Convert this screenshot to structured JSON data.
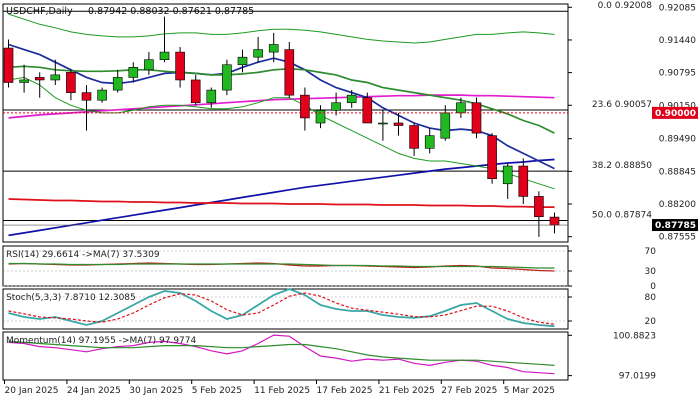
{
  "chart_data": {
    "type": "candlestick",
    "title": "USDCHF,Daily",
    "ohlc_header": "0.87942 0.88032 0.87621 0.87785",
    "price_scale": {
      "ylim": [
        0.8745,
        0.9215
      ],
      "ticks": [
        "0.92085",
        "0.91440",
        "0.90795",
        "0.90150",
        "0.89490",
        "0.88845",
        "0.88200",
        "0.87555"
      ],
      "last_price": "0.87785",
      "highlight_level": "0.90000",
      "colors": {
        "last_price": "#000000",
        "highlight_level": "#e0001b"
      }
    },
    "x_tick_labels": [
      "20 Jan 2025",
      "24 Jan 2025",
      "30 Jan 2025",
      "5 Feb 2025",
      "11 Feb 2025",
      "17 Feb 2025",
      "21 Feb 2025",
      "27 Feb 2025",
      "5 Mar 2025"
    ],
    "fib_levels": [
      {
        "label": "0.0 0.92008",
        "value": 0.92008
      },
      {
        "label": "23.6 0.90057",
        "value": 0.90057
      },
      {
        "label": "38.2 0.88850",
        "value": 0.8885
      },
      {
        "label": "50.0 0.87874",
        "value": 0.87874
      }
    ],
    "candles": [
      {
        "o": 0.9128,
        "h": 0.9145,
        "l": 0.905,
        "c": 0.906
      },
      {
        "o": 0.906,
        "h": 0.9095,
        "l": 0.904,
        "c": 0.9065
      },
      {
        "o": 0.907,
        "h": 0.908,
        "l": 0.903,
        "c": 0.9065
      },
      {
        "o": 0.9065,
        "h": 0.9105,
        "l": 0.9055,
        "c": 0.9075
      },
      {
        "o": 0.908,
        "h": 0.9085,
        "l": 0.9025,
        "c": 0.904
      },
      {
        "o": 0.904,
        "h": 0.9055,
        "l": 0.8965,
        "c": 0.9025
      },
      {
        "o": 0.9025,
        "h": 0.905,
        "l": 0.902,
        "c": 0.9045
      },
      {
        "o": 0.9045,
        "h": 0.9085,
        "l": 0.904,
        "c": 0.907
      },
      {
        "o": 0.907,
        "h": 0.91,
        "l": 0.906,
        "c": 0.909
      },
      {
        "o": 0.9085,
        "h": 0.912,
        "l": 0.9075,
        "c": 0.9105
      },
      {
        "o": 0.9105,
        "h": 0.919,
        "l": 0.91,
        "c": 0.912
      },
      {
        "o": 0.912,
        "h": 0.913,
        "l": 0.905,
        "c": 0.9065
      },
      {
        "o": 0.9065,
        "h": 0.9075,
        "l": 0.9015,
        "c": 0.902
      },
      {
        "o": 0.902,
        "h": 0.905,
        "l": 0.901,
        "c": 0.9045
      },
      {
        "o": 0.9045,
        "h": 0.9105,
        "l": 0.9035,
        "c": 0.9095
      },
      {
        "o": 0.9095,
        "h": 0.9125,
        "l": 0.908,
        "c": 0.911
      },
      {
        "o": 0.911,
        "h": 0.915,
        "l": 0.91,
        "c": 0.9125
      },
      {
        "o": 0.912,
        "h": 0.9158,
        "l": 0.91,
        "c": 0.9135
      },
      {
        "o": 0.9125,
        "h": 0.914,
        "l": 0.903,
        "c": 0.9035
      },
      {
        "o": 0.9035,
        "h": 0.905,
        "l": 0.8965,
        "c": 0.899
      },
      {
        "o": 0.898,
        "h": 0.9015,
        "l": 0.897,
        "c": 0.9005
      },
      {
        "o": 0.9005,
        "h": 0.904,
        "l": 0.8995,
        "c": 0.902
      },
      {
        "o": 0.902,
        "h": 0.9045,
        "l": 0.901,
        "c": 0.9035
      },
      {
        "o": 0.903,
        "h": 0.904,
        "l": 0.898,
        "c": 0.898
      },
      {
        "o": 0.898,
        "h": 0.9005,
        "l": 0.8945,
        "c": 0.898
      },
      {
        "o": 0.898,
        "h": 0.9,
        "l": 0.8955,
        "c": 0.8975
      },
      {
        "o": 0.8975,
        "h": 0.898,
        "l": 0.8915,
        "c": 0.893
      },
      {
        "o": 0.893,
        "h": 0.897,
        "l": 0.892,
        "c": 0.8955
      },
      {
        "o": 0.895,
        "h": 0.9015,
        "l": 0.8945,
        "c": 0.9
      },
      {
        "o": 0.9,
        "h": 0.903,
        "l": 0.899,
        "c": 0.902
      },
      {
        "o": 0.902,
        "h": 0.903,
        "l": 0.895,
        "c": 0.896
      },
      {
        "o": 0.8955,
        "h": 0.896,
        "l": 0.886,
        "c": 0.887
      },
      {
        "o": 0.886,
        "h": 0.89,
        "l": 0.883,
        "c": 0.8895
      },
      {
        "o": 0.8895,
        "h": 0.891,
        "l": 0.882,
        "c": 0.8835
      },
      {
        "o": 0.8835,
        "h": 0.8845,
        "l": 0.8755,
        "c": 0.8795
      },
      {
        "o": 0.87942,
        "h": 0.88032,
        "l": 0.87621,
        "c": 0.87785
      }
    ],
    "overlays": [
      {
        "color": "#1111aa",
        "values": [
          0.8758,
          0.8763,
          0.8768,
          0.8773,
          0.8778,
          0.8783,
          0.8788,
          0.8793,
          0.8798,
          0.8803,
          0.8808,
          0.8813,
          0.8818,
          0.8823,
          0.8828,
          0.8833,
          0.8838,
          0.8843,
          0.8848,
          0.8853,
          0.8857,
          0.8861,
          0.8865,
          0.8869,
          0.8873,
          0.8877,
          0.8881,
          0.8885,
          0.8889,
          0.8892,
          0.8895,
          0.8898,
          0.8901,
          0.8903,
          0.8906,
          0.8908
        ]
      },
      {
        "color": "#e0101b",
        "values": [
          0.883,
          0.8829,
          0.8828,
          0.8827,
          0.8827,
          0.8826,
          0.8825,
          0.8825,
          0.8824,
          0.8824,
          0.8823,
          0.8823,
          0.8822,
          0.8822,
          0.8822,
          0.8821,
          0.8821,
          0.8821,
          0.882,
          0.882,
          0.882,
          0.8819,
          0.8819,
          0.8819,
          0.8818,
          0.8818,
          0.8818,
          0.8817,
          0.8817,
          0.8817,
          0.8816,
          0.8816,
          0.8815,
          0.8815,
          0.8814,
          0.8814
        ]
      },
      {
        "color": "#e21ccf",
        "values": [
          0.899,
          0.8993,
          0.8996,
          0.8998,
          0.9,
          0.9002,
          0.9004,
          0.9006,
          0.9008,
          0.901,
          0.9012,
          0.9014,
          0.9016,
          0.9018,
          0.902,
          0.9022,
          0.9024,
          0.9026,
          0.9027,
          0.9028,
          0.9029,
          0.903,
          0.9031,
          0.9032,
          0.9033,
          0.9034,
          0.9034,
          0.9035,
          0.9035,
          0.9035,
          0.9034,
          0.9034,
          0.9033,
          0.9032,
          0.9031,
          0.903
        ]
      },
      {
        "color": "#1c2c9c",
        "values": [
          0.9135,
          0.9125,
          0.9115,
          0.91,
          0.9085,
          0.907,
          0.906,
          0.9058,
          0.9062,
          0.907,
          0.9078,
          0.908,
          0.9078,
          0.9075,
          0.9078,
          0.909,
          0.91,
          0.9108,
          0.91,
          0.9085,
          0.9065,
          0.905,
          0.904,
          0.903,
          0.901,
          0.8995,
          0.898,
          0.897,
          0.8965,
          0.8968,
          0.8965,
          0.8955,
          0.8935,
          0.892,
          0.8905,
          0.889
        ]
      },
      {
        "color": "#2e8b2e",
        "values": [
          0.909,
          0.9092,
          0.909,
          0.9085,
          0.9083,
          0.9082,
          0.9082,
          0.9083,
          0.9085,
          0.9085,
          0.9082,
          0.908,
          0.9078,
          0.9075,
          0.9075,
          0.9077,
          0.908,
          0.9085,
          0.9087,
          0.9085,
          0.908,
          0.9075,
          0.9065,
          0.906,
          0.905,
          0.9045,
          0.904,
          0.9035,
          0.903,
          0.9025,
          0.9018,
          0.9008,
          0.8998,
          0.8985,
          0.8975,
          0.896
        ]
      },
      {
        "color": "#1e9a1e",
        "values": [
          0.9195,
          0.9185,
          0.9175,
          0.9168,
          0.916,
          0.9155,
          0.9152,
          0.915,
          0.915,
          0.9152,
          0.9156,
          0.9158,
          0.9158,
          0.9155,
          0.9155,
          0.9158,
          0.9162,
          0.9165,
          0.9165,
          0.9163,
          0.916,
          0.9155,
          0.915,
          0.9145,
          0.9142,
          0.914,
          0.9138,
          0.914,
          0.9145,
          0.915,
          0.9155,
          0.9155,
          0.9158,
          0.916,
          0.9158,
          0.9155
        ]
      },
      {
        "color": "#1e9a1e",
        "values": [
          0.9065,
          0.907,
          0.9055,
          0.903,
          0.9015,
          0.9005,
          0.9,
          0.9,
          0.9005,
          0.9012,
          0.9015,
          0.9015,
          0.9012,
          0.9008,
          0.9008,
          0.9012,
          0.902,
          0.903,
          0.903,
          0.9015,
          0.8995,
          0.898,
          0.8965,
          0.895,
          0.8935,
          0.892,
          0.891,
          0.8905,
          0.8905,
          0.89,
          0.8895,
          0.889,
          0.888,
          0.887,
          0.886,
          0.885
        ]
      }
    ],
    "indicators": [
      {
        "label": "RSI(14) 29.6614 ->MA(7) 37.5309",
        "ylim": [
          0,
          80
        ],
        "ticks": [
          {
            "label": "70",
            "value": 70
          },
          {
            "label": "30",
            "value": 30
          },
          {
            "label": "0",
            "value": 0
          }
        ],
        "series": [
          {
            "color": "#c0201b",
            "values": [
              44,
              45,
              44,
              43,
              42,
              42,
              43,
              44,
              45,
              46,
              45,
              44,
              43,
              43,
              44,
              45,
              46,
              45,
              42,
              40,
              40,
              41,
              41,
              40,
              39,
              38,
              37,
              38,
              40,
              41,
              40,
              36,
              35,
              33,
              31,
              30
            ]
          },
          {
            "color": "#2e8b2e",
            "values": [
              45,
              45,
              44,
              44,
              43,
              43,
              43,
              43,
              44,
              44,
              44,
              44,
              44,
              44,
              44,
              44,
              44,
              44,
              44,
              43,
              42,
              41,
              41,
              41,
              40,
              40,
              39,
              39,
              39,
              39,
              39,
              39,
              38,
              37,
              36,
              36
            ]
          }
        ]
      },
      {
        "label": "Stoch(5,3,3) 7.8710 12.3085",
        "ylim": [
          0,
          100
        ],
        "ticks": [
          {
            "label": "80",
            "value": 80
          },
          {
            "label": "20",
            "value": 20
          }
        ],
        "series": [
          {
            "color": "#3aa6a6",
            "values": [
              40,
              30,
              25,
              30,
              20,
              10,
              20,
              40,
              60,
              80,
              95,
              90,
              70,
              45,
              25,
              35,
              60,
              85,
              100,
              85,
              60,
              50,
              45,
              45,
              35,
              30,
              28,
              32,
              45,
              60,
              65,
              45,
              25,
              15,
              10,
              7
            ]
          },
          {
            "color": "#e0101b",
            "values": [
              45,
              38,
              30,
              28,
              25,
              20,
              17,
              25,
              40,
              60,
              78,
              88,
              85,
              70,
              48,
              35,
              40,
              60,
              82,
              90,
              82,
              65,
              52,
              47,
              42,
              37,
              31,
              30,
              35,
              46,
              57,
              57,
              45,
              28,
              17,
              12
            ]
          }
        ]
      },
      {
        "label": "Momentum(14) 97.1955 ->MA(7) 97.9774",
        "ylim": [
          96.6,
          101.2
        ],
        "ticks": [
          {
            "label": "100.8823",
            "value": 100.8823
          },
          {
            "label": "97.0199",
            "value": 97.0199
          }
        ],
        "series": [
          {
            "color": "#d019c0",
            "values": [
              100.2,
              100.1,
              99.8,
              99.7,
              99.5,
              99.3,
              99.6,
              99.8,
              99.9,
              100.2,
              100.3,
              100.1,
              99.8,
              99.4,
              99.1,
              99.4,
              100.1,
              100.9,
              100.8,
              99.8,
              98.9,
              98.7,
              98.4,
              98.6,
              98.5,
              98.6,
              98.2,
              98.0,
              98.3,
              98.5,
              98.4,
              98.0,
              97.8,
              97.4,
              97.3,
              97.2
            ]
          },
          {
            "color": "#2e8b2e",
            "values": [
              100.3,
              100.2,
              100.1,
              100.0,
              99.9,
              99.8,
              99.7,
              99.7,
              99.7,
              99.8,
              99.9,
              99.9,
              99.9,
              99.8,
              99.7,
              99.7,
              99.8,
              99.9,
              100.0,
              100.0,
              99.8,
              99.6,
              99.3,
              99.0,
              98.8,
              98.7,
              98.6,
              98.5,
              98.5,
              98.5,
              98.5,
              98.4,
              98.3,
              98.2,
              98.1,
              98.0
            ]
          }
        ]
      }
    ],
    "colors": {
      "bull": "#22b822",
      "bear": "#e0001b"
    }
  }
}
